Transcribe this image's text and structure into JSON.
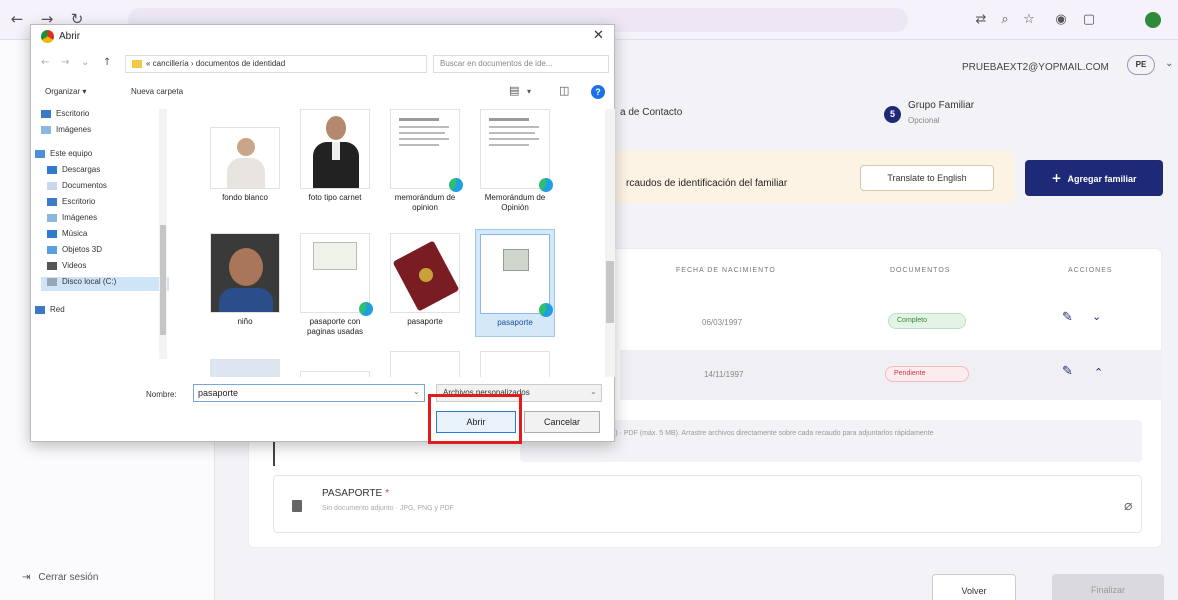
{
  "browser": {
    "url": "…"
  },
  "app": {
    "user_email": "PRUEBAEXT2@YOPMAIL.COM",
    "avatar_initials": "PE",
    "logout_label": "Cerrar sesión",
    "step_contact": "a de Contacto",
    "step_family_number": "5",
    "step_family_title": "Grupo Familiar",
    "step_family_sub": "Opcional",
    "banner_text": "rcaudos de identificación del familiar",
    "translate_label": "Translate to English",
    "add_family_label": "Agregar familiar",
    "table_headers": [
      "FECHA DE NACIMIENTO",
      "DOCUMENTOS",
      "ACCIONES"
    ],
    "rows": [
      {
        "date": "06/03/1997",
        "status": "Completo"
      },
      {
        "date": "14/11/1997",
        "status": "Pendiente"
      }
    ],
    "note": "…. JPG, PNG (máx. 3 MB) · PDF (máx. 5 MB). Arrastre archivos directamente sobre cada recaudo para adjuntarlos rápidamente",
    "doc_title": "PASAPORTE",
    "doc_required": "*",
    "doc_sub": "Sin documento adjunto · JPG, PNG y PDF",
    "back_label": "Volver",
    "finish_label": "Finalizar"
  },
  "dialog": {
    "title": "Abrir",
    "breadcrumb": "« cancillería › documentos de identidad",
    "search_placeholder": "Buscar en documentos de ide...",
    "organize": "Organizar ▾",
    "new_folder": "Nueva carpeta",
    "nav": [
      "Escritorio",
      "Imágenes",
      "Este equipo",
      "Descargas",
      "Documentos",
      "Escritorio",
      "Imágenes",
      "Música",
      "Objetos 3D",
      "Videos",
      "Disco local (C:)",
      "Red"
    ],
    "files": [
      {
        "label": "fondo blanco"
      },
      {
        "label": "foto tipo carnet"
      },
      {
        "label": "memorándum de opinion"
      },
      {
        "label": "Memorándum de Opinión"
      },
      {
        "label": "niño"
      },
      {
        "label": "pasaporte con paginas usadas"
      },
      {
        "label": "pasaporte"
      },
      {
        "label": "pasaporte"
      }
    ],
    "name_label": "Nombre:",
    "name_value": "pasaporte",
    "filter_value": "Archivos personalizados",
    "open_label": "Abrir",
    "cancel_label": "Cancelar"
  }
}
